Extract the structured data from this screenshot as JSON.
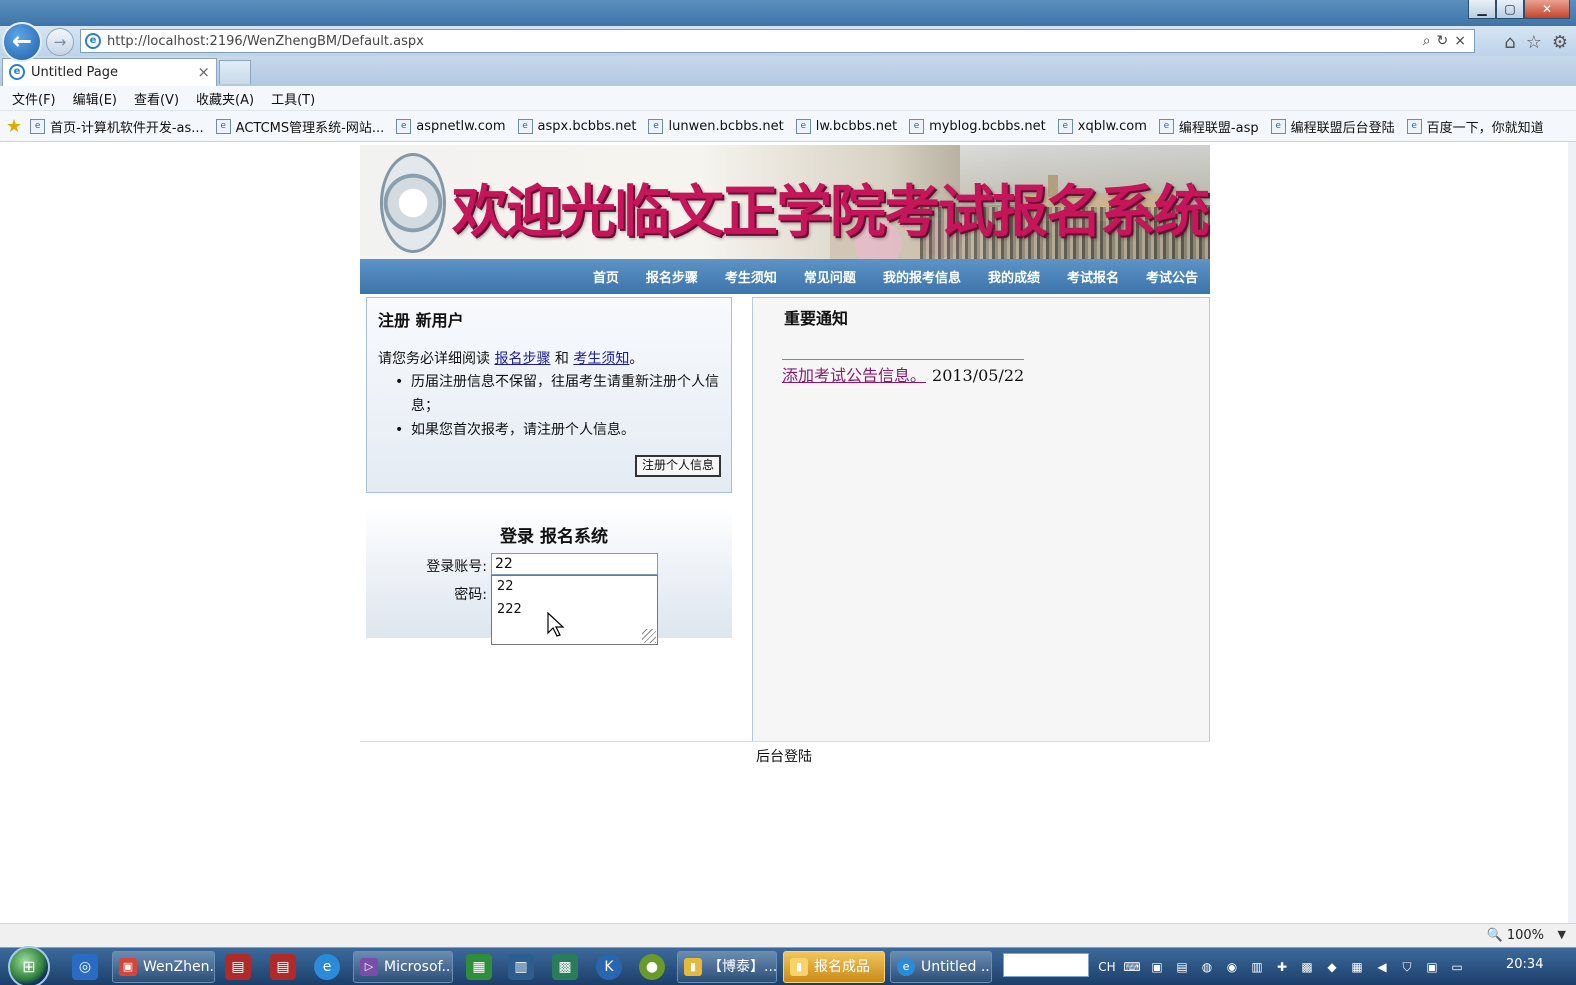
{
  "browser": {
    "title_faded": "",
    "url": "http://localhost:2196/WenZhengBM/Default.aspx",
    "tab_title": "Untitled Page",
    "tab_close": "×",
    "menu": [
      "文件(F)",
      "编辑(E)",
      "查看(V)",
      "收藏夹(A)",
      "工具(T)"
    ],
    "favorites": [
      "首页-计算机软件开发-as...",
      "ACTCMS管理系统-网站...",
      "aspnetlw.com",
      "aspx.bcbbs.net",
      "lunwen.bcbbs.net",
      "lw.bcbbs.net",
      "myblog.bcbbs.net",
      "xqblw.com",
      "编程联盟-asp",
      "编程联盟后台登陆",
      "百度一下，你就知道"
    ],
    "zoom": "100%",
    "icons": {
      "back": "←",
      "forward": "→",
      "search": "⌕",
      "refresh": "↻",
      "stop": "×",
      "home": "⌂",
      "star": "☆",
      "gear": "⚙",
      "min": "▁",
      "max": "▢",
      "close": "✕"
    }
  },
  "page": {
    "banner_title": "欢迎光临文正学院考试报名系统",
    "nav": [
      "首页",
      "报名步骤",
      "考生须知",
      "常见问题",
      "我的报考信息",
      "我的成绩",
      "考试报名",
      "考试公告"
    ],
    "register": {
      "title": "注册 新用户",
      "intro_prefix": "请您务必详细阅读 ",
      "link1": "报名步骤",
      "intro_mid": " 和 ",
      "link2": "考生须知",
      "intro_suffix": "。",
      "items": [
        "历届注册信息不保留，往届考生请重新注册个人信息；",
        "如果您首次报考，请注册个人信息。"
      ],
      "button": "注册个人信息"
    },
    "login": {
      "title": "登录 报名系统",
      "account_label": "登录账号:",
      "account_value": "22",
      "password_label": "密码:",
      "suggestions": [
        "22",
        "222"
      ]
    },
    "notice": {
      "title": "重要通知",
      "link": "添加考试公告信息。",
      "date": "2013/05/22"
    },
    "footer_link": "后台登陆"
  },
  "taskbar": {
    "buttons": [
      {
        "label": "WenZhen...",
        "active": false
      },
      {
        "label": "Microsof...",
        "active": false
      },
      {
        "label": "【博泰】...",
        "active": false
      },
      {
        "label": "报名成品",
        "active": true
      },
      {
        "label": "Untitled ...",
        "active": false
      }
    ],
    "tray_lang": "CH",
    "clock": "20:34"
  },
  "colors": {
    "nav_bg": "#3c75ac",
    "banner_title": "#c5165a",
    "link": "#1b1ba1",
    "notice_link": "#8c1a6a"
  }
}
